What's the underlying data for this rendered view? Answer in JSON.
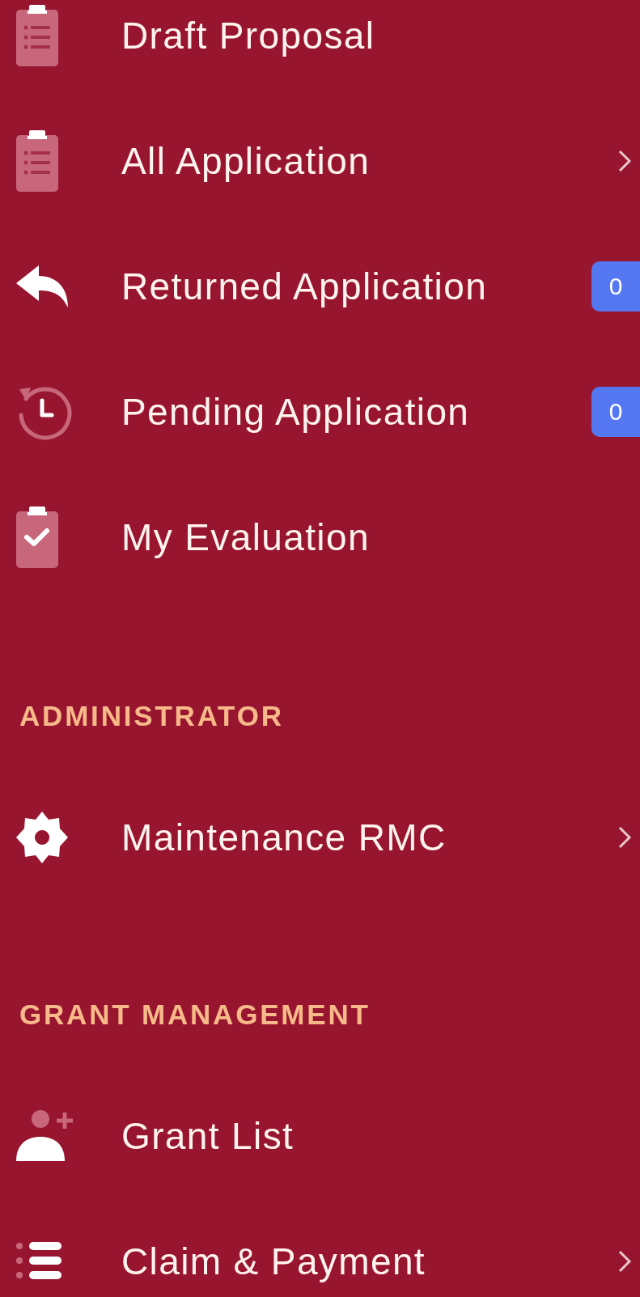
{
  "sections": [
    {
      "items": [
        {
          "kind": "clipboard-list",
          "label": "Draft Proposal",
          "expandable": false
        },
        {
          "kind": "clipboard-list",
          "label": "All Application",
          "expandable": true
        },
        {
          "kind": "reply",
          "label": "Returned Application",
          "expandable": false,
          "badge": "0"
        },
        {
          "kind": "history",
          "label": "Pending Application",
          "expandable": false,
          "badge": "0"
        },
        {
          "kind": "clipboard-check",
          "label": "My Evaluation",
          "expandable": false
        }
      ]
    },
    {
      "header": "ADMINISTRATOR",
      "items": [
        {
          "kind": "gear",
          "label": "Maintenance RMC",
          "expandable": true
        }
      ]
    },
    {
      "header": "GRANT MANAGEMENT",
      "items": [
        {
          "kind": "user-plus",
          "label": "Grant List",
          "expandable": false
        },
        {
          "kind": "list",
          "label": "Claim & Payment",
          "expandable": true
        }
      ]
    }
  ]
}
